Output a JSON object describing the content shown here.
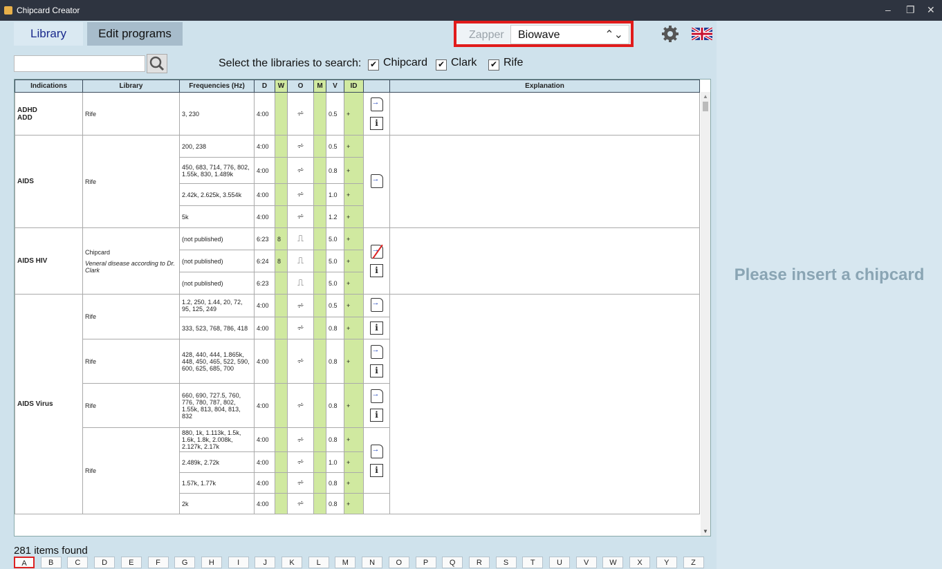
{
  "window": {
    "title": "Chipcard Creator",
    "min": "–",
    "max": "❐",
    "close": "✕"
  },
  "tabs": {
    "library": "Library",
    "edit_programs": "Edit programs"
  },
  "zapper": {
    "label": "Zapper",
    "value": "Biowave",
    "arrows": "⌃⌄"
  },
  "search": {
    "placeholder": ""
  },
  "libraries": {
    "label": "Select the libraries to search:",
    "options": [
      {
        "label": "Chipcard",
        "checked": true
      },
      {
        "label": "Clark",
        "checked": true
      },
      {
        "label": "Rife",
        "checked": true
      }
    ]
  },
  "table": {
    "headers": [
      "Indications",
      "Library",
      "Frequencies (Hz)",
      "D",
      "W",
      "O",
      "M",
      "V",
      "ID",
      "",
      "Explanation"
    ],
    "groups": [
      {
        "indication": "ADHD\nADD",
        "rows": [
          {
            "library": "Rife",
            "freq": "3, 230",
            "d": "4:00",
            "w": "",
            "o": "wave-sine",
            "v": "0.5",
            "id": "+"
          }
        ]
      },
      {
        "indication": "AIDS",
        "rows": [
          {
            "library": "Rife",
            "freq": "200, 238",
            "d": "4:00",
            "w": "",
            "o": "wave-sine",
            "v": "0.5",
            "id": "+"
          },
          {
            "library": "",
            "freq": "450, 683, 714, 776, 802, 1.55k, 830, 1.489k",
            "d": "4:00",
            "w": "",
            "o": "wave-sine",
            "v": "0.8",
            "id": "+"
          },
          {
            "library": "",
            "freq": "2.42k, 2.625k, 3.554k",
            "d": "4:00",
            "w": "",
            "o": "wave-sine",
            "v": "1.0",
            "id": "+"
          },
          {
            "library": "",
            "freq": "5k",
            "d": "4:00",
            "w": "",
            "o": "wave-sine",
            "v": "1.2",
            "id": "+"
          }
        ]
      },
      {
        "indication": "AIDS HIV",
        "rows": [
          {
            "library": "Chipcard",
            "freq": "(not published)",
            "d": "6:23",
            "w": "8",
            "o": "wave-square",
            "v": "5.0",
            "id": "+"
          },
          {
            "library": "Veneral disease according to Dr. Clark",
            "freq": "(not published)",
            "d": "6:24",
            "w": "8",
            "o": "wave-square",
            "v": "5.0",
            "id": "+"
          },
          {
            "library": "",
            "freq": "(not published)",
            "d": "6:23",
            "w": "",
            "o": "wave-square",
            "v": "5.0",
            "id": "+"
          }
        ]
      },
      {
        "indication": "AIDS Virus",
        "rows": [
          {
            "library": "Rife",
            "freq": "1.2, 250, 1.44, 20, 72, 95, 125, 249",
            "d": "4:00",
            "w": "",
            "o": "wave-sine",
            "v": "0.5",
            "id": "+"
          },
          {
            "library": "",
            "freq": "333, 523, 768, 786, 418",
            "d": "4:00",
            "w": "",
            "o": "wave-sine",
            "v": "0.8",
            "id": "+"
          },
          {
            "library": "Rife",
            "freq": "428, 440, 444, 1.865k, 448, 450, 465, 522, 590, 600, 625, 685, 700",
            "d": "4:00",
            "w": "",
            "o": "wave-sine",
            "v": "0.8",
            "id": "+"
          },
          {
            "library": "Rife",
            "freq": "660, 690, 727.5, 760, 776, 780, 787, 802, 1.55k, 813, 804, 813, 832",
            "d": "4:00",
            "w": "",
            "o": "wave-sine",
            "v": "0.8",
            "id": "+"
          },
          {
            "library": "Rife",
            "freq": "880, 1k, 1.113k, 1.5k, 1.6k, 1.8k, 2.008k, 2.127k, 2.17k",
            "d": "4:00",
            "w": "",
            "o": "wave-sine",
            "v": "0.8",
            "id": "+"
          },
          {
            "library": "",
            "freq": "2.489k, 2.72k",
            "d": "4:00",
            "w": "",
            "o": "wave-sine",
            "v": "1.0",
            "id": "+"
          },
          {
            "library": "",
            "freq": "1.57k, 1.77k",
            "d": "4:00",
            "w": "",
            "o": "wave-sine",
            "v": "0.8",
            "id": "+"
          },
          {
            "library": "",
            "freq": "2k",
            "d": "4:00",
            "w": "",
            "o": "wave-sine",
            "v": "0.8",
            "id": "+"
          }
        ]
      }
    ]
  },
  "status": {
    "items_found": "281 items found"
  },
  "alphabet": [
    "A",
    "B",
    "C",
    "D",
    "E",
    "F",
    "G",
    "H",
    "I",
    "J",
    "K",
    "L",
    "M",
    "N",
    "O",
    "P",
    "Q",
    "R",
    "S",
    "T",
    "U",
    "V",
    "W",
    "X",
    "Y",
    "Z"
  ],
  "alphabet_selected": "A",
  "right_panel": {
    "message": "Please insert a chipcard"
  },
  "colors": {
    "accent_red": "#e11b1b",
    "green_col": "#d0e9a0",
    "panel_bg": "#d7e7f0"
  },
  "icons": [
    "gear-icon",
    "uk-flag-icon",
    "search-icon",
    "card-transfer-icon",
    "info-icon"
  ]
}
